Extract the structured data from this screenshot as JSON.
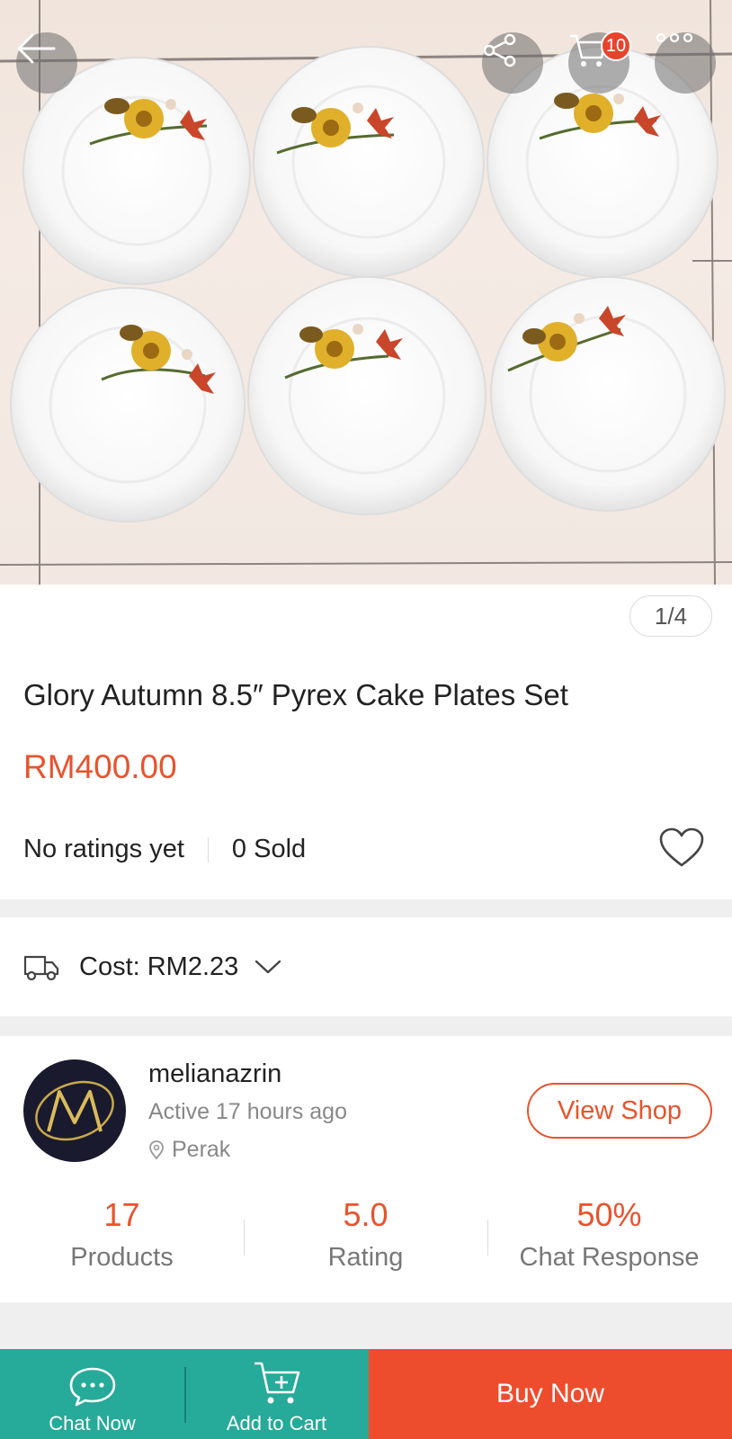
{
  "header": {
    "back_icon": "back-arrow-icon",
    "share_icon": "share-icon",
    "cart_icon": "cart-icon",
    "cart_count": "10",
    "more_icon": "more-icon"
  },
  "gallery": {
    "counter": "1/4"
  },
  "product": {
    "title": "Glory Autumn 8.5″ Pyrex Cake Plates Set",
    "price": "RM400.00",
    "ratings": "No ratings yet",
    "sold": "0 Sold"
  },
  "shipping": {
    "cost_label": "Cost: RM2.23"
  },
  "shop": {
    "name": "melianazrin",
    "active": "Active 17 hours ago",
    "location": "Perak",
    "view_shop_label": "View Shop",
    "metrics": [
      {
        "value": "17",
        "label": "Products"
      },
      {
        "value": "5.0",
        "label": "Rating"
      },
      {
        "value": "50%",
        "label": "Chat Response"
      }
    ]
  },
  "bottom_bar": {
    "chat_label": "Chat Now",
    "cart_label": "Add to Cart",
    "buy_label": "Buy Now"
  },
  "colors": {
    "accent": "#ee4d2d",
    "teal": "#26aa99",
    "price": "#e8532d"
  }
}
